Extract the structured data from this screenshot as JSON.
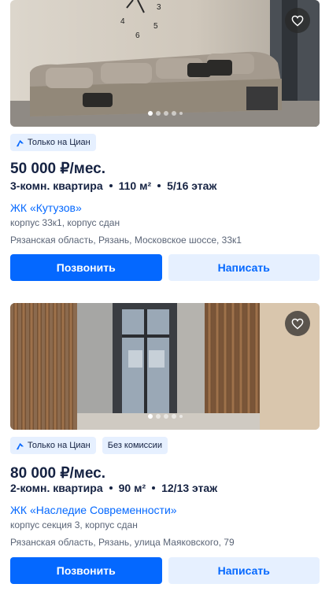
{
  "listings": [
    {
      "photo_dots": 5,
      "photo_active_dot": 0,
      "badges": [
        "Только на Циан"
      ],
      "price": "50 000 ₽/мес.",
      "params": [
        "3-комн. квартира",
        "110 м²",
        "5/16 этаж"
      ],
      "complex": "ЖК «Кутузов»",
      "building": "корпус 33к1, корпус сдан",
      "address": "Рязанская область, Рязань, Московское шоссе, 33к1",
      "call_label": "Позвонить",
      "write_label": "Написать",
      "favorite_icon": "heart-outline-icon"
    },
    {
      "photo_dots": 5,
      "photo_active_dot": 0,
      "badges": [
        "Только на Циан",
        "Без комиссии"
      ],
      "price": "80 000 ₽/мес.",
      "params": [
        "2-комн. квартира",
        "90 м²",
        "12/13 этаж"
      ],
      "complex": "ЖК «Наследие Современности»",
      "building": "корпус секция 3, корпус сдан",
      "address": "Рязанская область, Рязань, улица Маяковского, 79",
      "call_label": "Позвонить",
      "write_label": "Написать",
      "favorite_icon": "heart-outline-icon"
    }
  ],
  "colors": {
    "primary": "#0468ff",
    "primary_light": "#e6f0ff",
    "text": "#152242",
    "secondary_text": "#5a6476"
  }
}
